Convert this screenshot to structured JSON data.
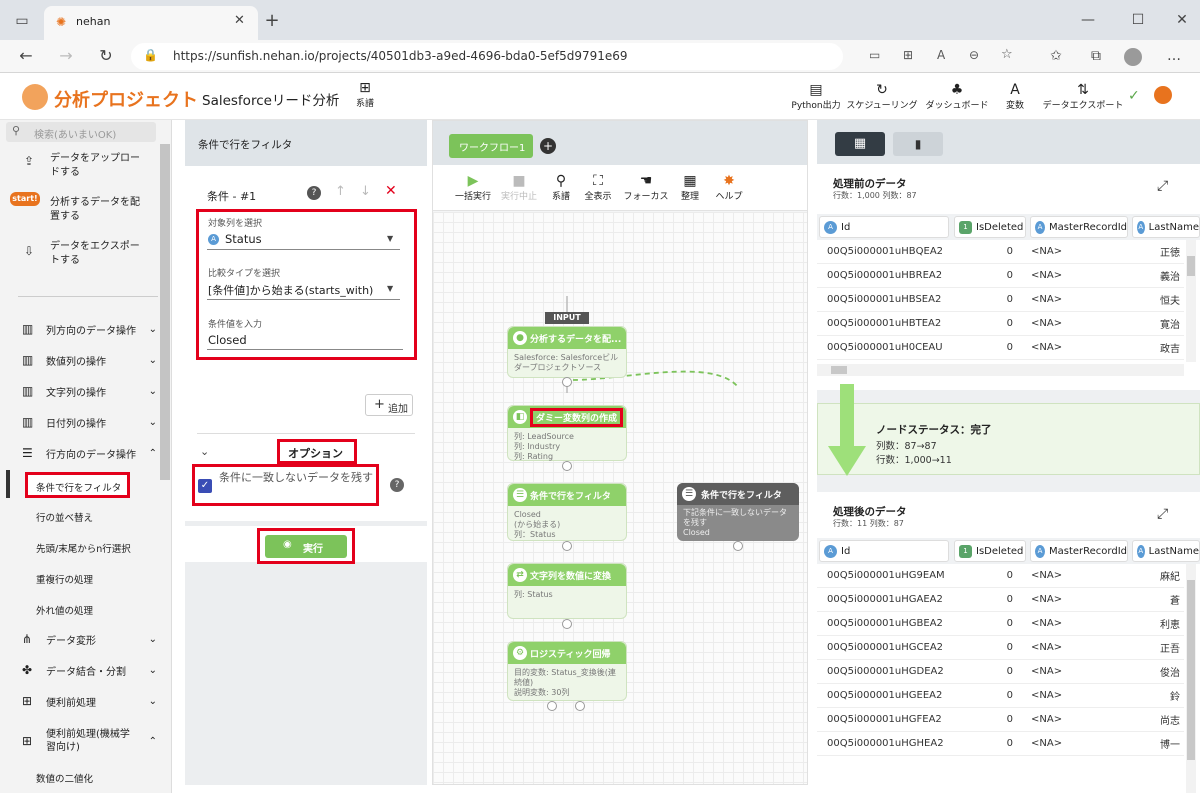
{
  "browser": {
    "tab_title": "nehan",
    "url": "https://sunfish.nehan.io/projects/40501db3-a9ed-4696-bda0-5ef5d9791e69"
  },
  "app": {
    "brand": "分析プロジェクト",
    "project_name": "Salesforceリード分析",
    "lineage_label": "系譜",
    "toolbar": [
      {
        "label": "Python出力",
        "icon": "file-icon"
      },
      {
        "label": "スケジューリング",
        "icon": "refresh-icon"
      },
      {
        "label": "ダッシュボード",
        "icon": "tree-icon"
      },
      {
        "label": "変数",
        "icon": "variable-icon"
      },
      {
        "label": "データエクスポート",
        "icon": "export-icon"
      }
    ]
  },
  "sidebar": {
    "search_placeholder": "検索(あいまいOK)",
    "top_items": [
      "データをアップロードする",
      "分析するデータを配置する",
      "データをエクスポートする"
    ],
    "start_badge": "start!",
    "menus": [
      "列方向のデータ操作",
      "数値列の操作",
      "文字列の操作",
      "日付列の操作",
      "行方向のデータ操作"
    ],
    "sub_items": [
      "条件で行をフィルタ",
      "行の並べ替え",
      "先頭/末尾からn行選択",
      "重複行の処理",
      "外れ値の処理"
    ],
    "lower_menus": [
      "データ変形",
      "データ結合・分割",
      "便利前処理",
      "便利前処理(機械学習向け)"
    ],
    "last_item": "数値の二値化"
  },
  "filter_panel": {
    "title": "条件で行をフィルタ",
    "condition_title": "条件 - #1",
    "target_column_label": "対象列を選択",
    "target_column_value": "Status",
    "compare_type_label": "比較タイプを選択",
    "compare_type_value": "[条件値]から始まる(starts_with)",
    "condition_value_label": "条件値を入力",
    "condition_value": "Closed",
    "add_button": "追加",
    "options_label": "オプション",
    "keep_unmatched_label": "条件に一致しないデータを残す",
    "keep_unmatched_checked": true,
    "run_button": "実行"
  },
  "workflow": {
    "tab_label": "ワークフロー1",
    "toolbar": [
      "一括実行",
      "実行中止",
      "系譜",
      "全表示",
      "フォーカス",
      "整理",
      "ヘルプ"
    ],
    "input_label": "INPUT",
    "nodes": [
      {
        "title": "分析するデータを配...",
        "body": [
          "Salesforce: Salesforceビルダープロジェクトソース"
        ]
      },
      {
        "title": "ダミー変数列の作成",
        "body": [
          "列: LeadSource",
          "列: Industry",
          "列: Rating"
        ]
      },
      {
        "title": "条件で行をフィルタ",
        "body": [
          "Closed",
          "(から始まる)",
          "列：Status"
        ]
      },
      {
        "title": "文字列を数値に変換",
        "body": [
          "列: Status"
        ]
      },
      {
        "title": "ロジスティック回帰",
        "body": [
          "目的変数: Status_変換後(連続値)",
          "説明変数: 30列"
        ]
      }
    ],
    "floating_node": {
      "title": "条件で行をフィルタ",
      "body": [
        "下記条件に一致しないデータを残す",
        "Closed"
      ]
    }
  },
  "before_data": {
    "title": "処理前のデータ",
    "meta": "行数：1,000 列数：87",
    "columns": [
      "Id",
      "IsDeleted",
      "MasterRecordId",
      "LastName"
    ],
    "rows": [
      [
        "00Q5i000001uHBQEA2",
        "0",
        "<NA>",
        "正徳"
      ],
      [
        "00Q5i000001uHBREA2",
        "0",
        "<NA>",
        "義治"
      ],
      [
        "00Q5i000001uHBSEA2",
        "0",
        "<NA>",
        "恒夫"
      ],
      [
        "00Q5i000001uHBTEA2",
        "0",
        "<NA>",
        "寛治"
      ],
      [
        "00Q5i000001uH0CEAU",
        "0",
        "<NA>",
        "政吉"
      ]
    ]
  },
  "node_status": {
    "title": "ノードステータス：完了",
    "columns": "列数：87→87",
    "rows": "行数：1,000→11"
  },
  "after_data": {
    "title": "処理後のデータ",
    "meta": "行数：11 列数：87",
    "columns": [
      "Id",
      "IsDeleted",
      "MasterRecordId",
      "LastName"
    ],
    "rows": [
      [
        "00Q5i000001uHG9EAM",
        "0",
        "<NA>",
        "麻紀"
      ],
      [
        "00Q5i000001uHGAEA2",
        "0",
        "<NA>",
        "蒼"
      ],
      [
        "00Q5i000001uHGBEA2",
        "0",
        "<NA>",
        "利恵"
      ],
      [
        "00Q5i000001uHGCEA2",
        "0",
        "<NA>",
        "正吾"
      ],
      [
        "00Q5i000001uHGDEA2",
        "0",
        "<NA>",
        "俊治"
      ],
      [
        "00Q5i000001uHGEEA2",
        "0",
        "<NA>",
        "鈴"
      ],
      [
        "00Q5i000001uHGFEA2",
        "0",
        "<NA>",
        "尚志"
      ],
      [
        "00Q5i000001uHGHEA2",
        "0",
        "<NA>",
        "博一"
      ]
    ]
  },
  "colors": {
    "accent_green": "#7cc35a",
    "highlight_red": "#e3001b",
    "brand_orange": "#e8731e"
  }
}
